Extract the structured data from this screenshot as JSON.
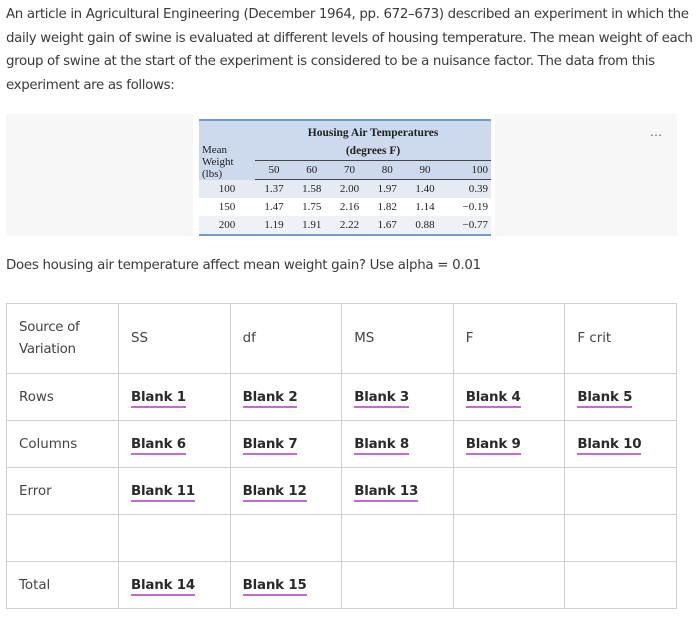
{
  "intro_text": "An article in Agricultural Engineering (December 1964, pp. 672–673) described an experiment in which the daily weight gain of swine is evaluated at different levels of housing temperature. The mean weight of each group of swine at the start of the experiment is considered to be a nuisance factor. The data from this experiment are as follows:",
  "figure": {
    "more_icon": "⋯",
    "row_header": [
      "Mean",
      "Weight",
      "(lbs)"
    ],
    "col_group_title": "Housing Air Temperatures",
    "col_group_subtitle": "(degrees F)",
    "columns": [
      "50",
      "60",
      "70",
      "80",
      "90",
      "100"
    ],
    "rows": [
      {
        "weight": "100",
        "values": [
          "1.37",
          "1.58",
          "2.00",
          "1.97",
          "1.40",
          "0.39"
        ]
      },
      {
        "weight": "150",
        "values": [
          "1.47",
          "1.75",
          "2.16",
          "1.82",
          "1.14",
          "−0.19"
        ]
      },
      {
        "weight": "200",
        "values": [
          "1.19",
          "1.91",
          "2.22",
          "1.67",
          "0.88",
          "−0.77"
        ]
      }
    ]
  },
  "question": "Does housing air temperature affect mean weight gain? Use alpha = 0.01",
  "anova": {
    "headers": [
      "Source of Variation",
      "SS",
      "df",
      "MS",
      "F",
      "F crit"
    ],
    "rows": [
      {
        "label": "Rows",
        "cells": [
          "Blank 1",
          "Blank 2",
          "Blank 3",
          "Blank 4",
          "Blank 5"
        ]
      },
      {
        "label": "Columns",
        "cells": [
          "Blank 6",
          "Blank 7",
          "Blank 8",
          "Blank 9",
          "Blank 10"
        ]
      },
      {
        "label": "Error",
        "cells": [
          "Blank 11",
          "Blank 12",
          "Blank 13",
          "",
          ""
        ]
      },
      {
        "label": "",
        "cells": [
          "",
          "",
          "",
          "",
          ""
        ]
      },
      {
        "label": "Total",
        "cells": [
          "Blank 14",
          "Blank 15",
          "",
          "",
          ""
        ]
      }
    ]
  },
  "colors": {
    "blank_underline": "#c26bd0",
    "header_blue": "#cdd9ec",
    "rule_blue": "#6f9ccf"
  }
}
